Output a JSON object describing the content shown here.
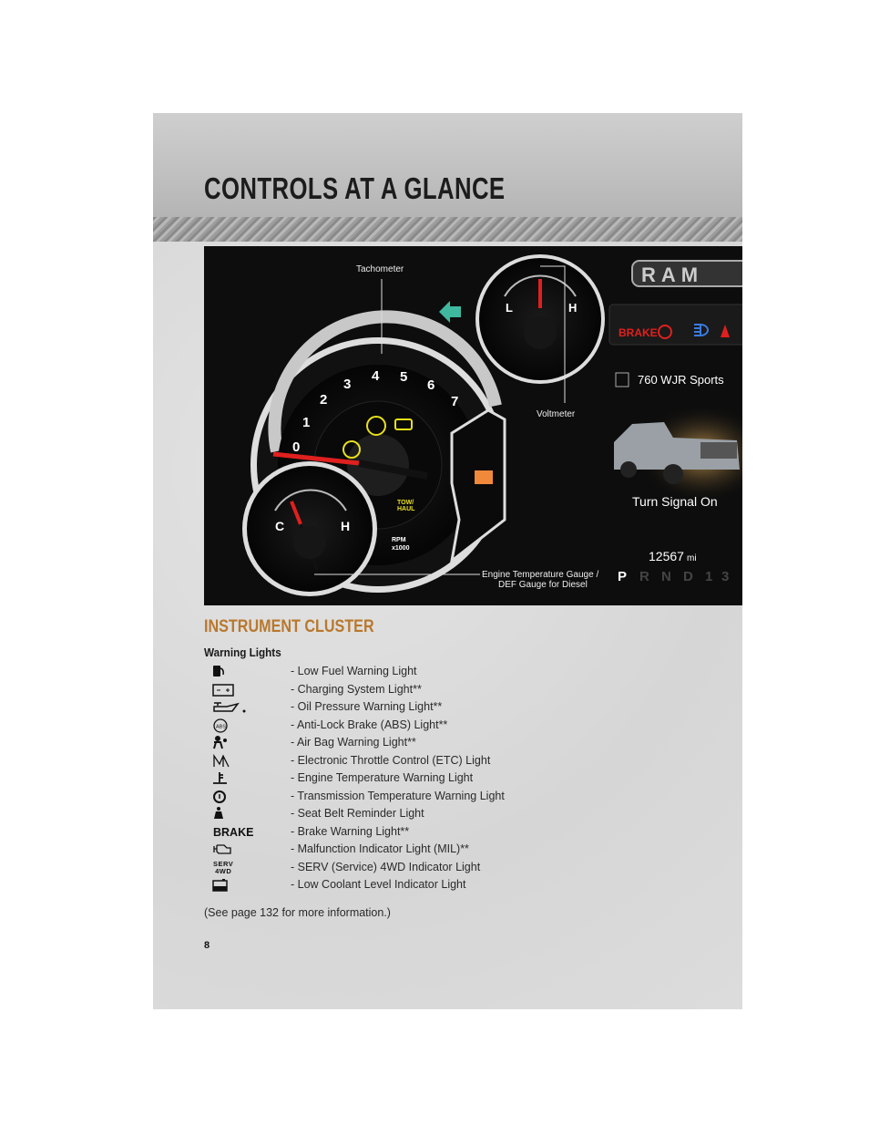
{
  "header": {
    "title": "CONTROLS AT A GLANCE"
  },
  "cluster": {
    "labels": {
      "tachometer": "Tachometer",
      "voltmeter": "Voltmeter",
      "engine_temp_1": "Engine Temperature Gauge /",
      "engine_temp_2": "DEF Gauge for Diesel"
    },
    "tach_numbers": [
      "0",
      "1",
      "2",
      "3",
      "4",
      "5",
      "6",
      "7"
    ],
    "rpm_1": "RPM",
    "rpm_2": "x1000",
    "tow_1": "TOW/",
    "tow_2": "HAUL",
    "volt_low": "L",
    "volt_high": "H",
    "temp_low": "C",
    "temp_high": "H",
    "brand": "RAM",
    "brake": "BRAKE",
    "radio": "760 WJR Sports",
    "message": "Turn Signal On",
    "odometer": "12567",
    "odometer_unit": "mi",
    "gears": [
      "P",
      "R",
      "N",
      "D",
      "1",
      "3"
    ],
    "colors": {
      "accent_red": "#e0201e",
      "warning_yellow": "#e8e01a",
      "turn_green": "#3fb8a0",
      "info_blue": "#3a7be0"
    }
  },
  "section": {
    "title": "INSTRUMENT CLUSTER",
    "subtitle": "Warning Lights"
  },
  "warning_lights": [
    {
      "icon": "fuel-pump-icon",
      "label": "- Low Fuel Warning Light"
    },
    {
      "icon": "battery-icon",
      "label": "- Charging System Light**"
    },
    {
      "icon": "oil-can-icon",
      "label": "- Oil Pressure Warning Light**"
    },
    {
      "icon": "abs-icon",
      "label": "- Anti-Lock Brake (ABS) Light**"
    },
    {
      "icon": "airbag-icon",
      "label": "- Air Bag Warning Light**"
    },
    {
      "icon": "etc-icon",
      "label": "- Electronic Throttle Control (ETC) Light"
    },
    {
      "icon": "thermometer-icon",
      "label": "- Engine Temperature Warning Light"
    },
    {
      "icon": "transmission-temp-icon",
      "label": "- Transmission Temperature Warning Light"
    },
    {
      "icon": "seatbelt-icon",
      "label": "- Seat Belt Reminder Light"
    },
    {
      "icon": "brake-text-icon",
      "icon_text": "BRAKE",
      "label": "- Brake Warning Light**"
    },
    {
      "icon": "engine-icon",
      "label": "- Malfunction Indicator Light (MIL)**"
    },
    {
      "icon": "serv-4wd-icon",
      "icon_text_1": "SERV",
      "icon_text_2": "4WD",
      "label": "- SERV (Service) 4WD Indicator Light"
    },
    {
      "icon": "coolant-icon",
      "label": "- Low Coolant Level Indicator Light"
    }
  ],
  "note": "(See page 132 for more information.)",
  "page_number": "8"
}
